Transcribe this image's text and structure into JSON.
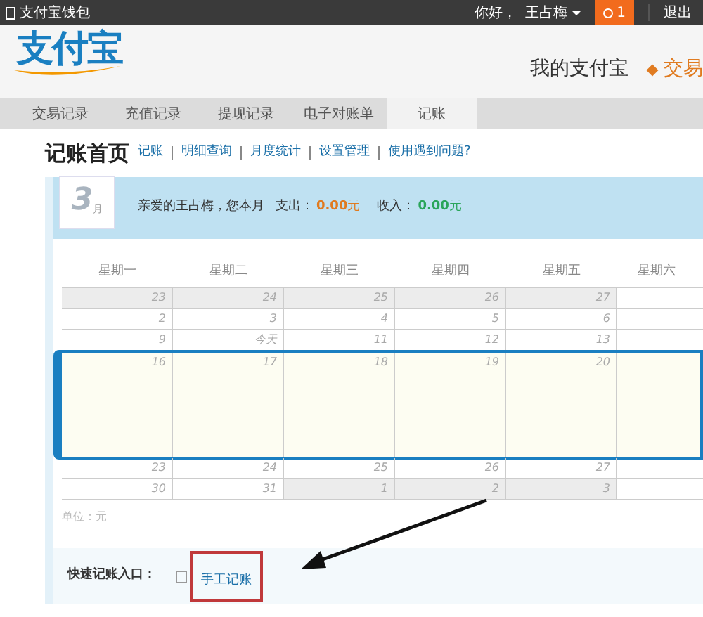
{
  "top_bar": {
    "app_link": "支付宝钱包",
    "greeting": "你好，",
    "user": "王占梅",
    "notifications": "1",
    "logout": "退出"
  },
  "header": {
    "logo": "支付宝",
    "nav": [
      {
        "label": "我的支付宝",
        "selected": false
      },
      {
        "label": "交易",
        "selected": true
      }
    ]
  },
  "tabs": [
    {
      "label": "交易记录",
      "selected": false
    },
    {
      "label": "充值记录",
      "selected": false
    },
    {
      "label": "提现记录",
      "selected": false
    },
    {
      "label": "电子对账单",
      "selected": false
    },
    {
      "label": "记账",
      "selected": true
    }
  ],
  "page_title": "记账首页",
  "links": [
    "记账",
    "明细查询",
    "月度统计",
    "设置管理",
    "使用遇到问题?"
  ],
  "summary": {
    "month": "3",
    "month_unit": "月",
    "greeting": "亲爱的王占梅，您本月",
    "expense_label": "支出：",
    "expense": "0.00",
    "expense_unit": "元",
    "income_label": "收入：",
    "income": "0.00",
    "income_unit": "元"
  },
  "calendar": {
    "weekdays": [
      "星期一",
      "星期二",
      "星期三",
      "星期四",
      "星期五",
      "星期六"
    ],
    "weeks": [
      {
        "selected": false,
        "days": [
          {
            "day": "23",
            "other_month": true
          },
          {
            "day": "24",
            "other_month": true
          },
          {
            "day": "25",
            "other_month": true
          },
          {
            "day": "26",
            "other_month": true
          },
          {
            "day": "27",
            "other_month": true
          }
        ]
      },
      {
        "selected": false,
        "days": [
          {
            "day": "2",
            "other_month": false
          },
          {
            "day": "3",
            "other_month": false
          },
          {
            "day": "4",
            "other_month": false
          },
          {
            "day": "5",
            "other_month": false
          },
          {
            "day": "6",
            "other_month": false
          }
        ]
      },
      {
        "selected": false,
        "days": [
          {
            "day": "9",
            "other_month": false
          },
          {
            "day": "今天",
            "other_month": false
          },
          {
            "day": "11",
            "other_month": false
          },
          {
            "day": "12",
            "other_month": false
          },
          {
            "day": "13",
            "other_month": false
          }
        ]
      },
      {
        "selected": true,
        "days": [
          {
            "day": "16",
            "other_month": false
          },
          {
            "day": "17",
            "other_month": false
          },
          {
            "day": "18",
            "other_month": false
          },
          {
            "day": "19",
            "other_month": false
          },
          {
            "day": "20",
            "other_month": false
          }
        ]
      },
      {
        "selected": false,
        "days": [
          {
            "day": "23",
            "other_month": false
          },
          {
            "day": "24",
            "other_month": false
          },
          {
            "day": "25",
            "other_month": false
          },
          {
            "day": "26",
            "other_month": false
          },
          {
            "day": "27",
            "other_month": false
          }
        ]
      },
      {
        "selected": false,
        "days": [
          {
            "day": "30",
            "other_month": false
          },
          {
            "day": "31",
            "other_month": false
          },
          {
            "day": "1",
            "other_month": true
          },
          {
            "day": "2",
            "other_month": true
          },
          {
            "day": "3",
            "other_month": true
          }
        ]
      }
    ],
    "unit_note": "单位：元"
  },
  "quick_entry": {
    "label": "快速记账入口：",
    "link": "手工记账",
    "highlighted": true
  },
  "annotation_arrow": true
}
